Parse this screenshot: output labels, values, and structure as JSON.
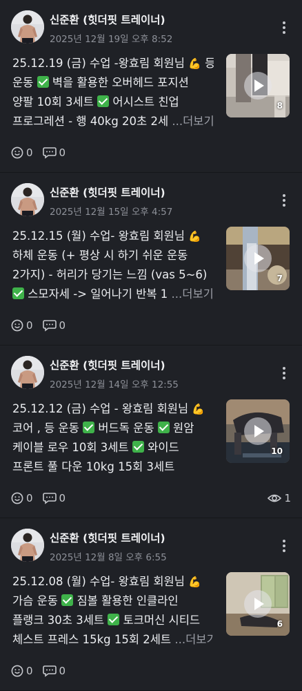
{
  "posts": [
    {
      "author": "신준환 (힛더핏 트레이너)",
      "date": "2025년 12월 19일 오후 8:52",
      "lines": [
        [
          {
            "t": "25.12.19 (금) 수업 -왕효림 회원님 "
          },
          {
            "e": "💪"
          },
          {
            "t": " 등"
          }
        ],
        [
          {
            "t": "운동 "
          },
          {
            "c": 1
          },
          {
            "t": " 벽을 활용한 오버헤드 포지션"
          }
        ],
        [
          {
            "t": "양팔 10회 3세트 "
          },
          {
            "c": 1
          },
          {
            "t": " 어시스트 친업"
          }
        ],
        [
          {
            "t": "프로그레션 - 행 40kg 20초 2세 "
          },
          {
            "m": "...더보기"
          }
        ]
      ],
      "media_count": "8",
      "comment_count": "0",
      "reaction_count": "0",
      "thumb": "t1"
    },
    {
      "author": "신준환 (힛더핏 트레이너)",
      "date": "2025년 12월 15일 오후 4:57",
      "lines": [
        [
          {
            "t": "25.12.15 (월) 수업- 왕효림 회원님 "
          },
          {
            "e": "💪"
          }
        ],
        [
          {
            "t": "하체 운동 (+ 평상 시 하기 쉬운 운동"
          }
        ],
        [
          {
            "t": "2가지) - 허리가 당기는 느낌 (vas 5~6)"
          }
        ],
        [
          {
            "c": 1
          },
          {
            "t": " 스모자세 -> 일어나기 반복 1 "
          },
          {
            "m": "...더보기"
          }
        ]
      ],
      "media_count": "7",
      "comment_count": "0",
      "reaction_count": "0",
      "thumb": "t2"
    },
    {
      "author": "신준환 (힛더핏 트레이너)",
      "date": "2025년 12월 14일 오후 12:55",
      "lines": [
        [
          {
            "t": "25.12.12 (금) 수업 - 왕효림 회원님 "
          },
          {
            "e": "💪"
          }
        ],
        [
          {
            "t": "코어 , 등 운동 "
          },
          {
            "c": 1
          },
          {
            "t": " 버드독 운동 "
          },
          {
            "c": 1
          },
          {
            "t": " 원암"
          }
        ],
        [
          {
            "t": "케이블 로우 10회 3세트 "
          },
          {
            "c": 1
          },
          {
            "t": " 와이드"
          }
        ],
        [
          {
            "t": "프론트 풀 다운 10kg 15회 3세트"
          }
        ]
      ],
      "media_count": "10",
      "comment_count": "0",
      "reaction_count": "0",
      "view_count": "1",
      "thumb": "t3"
    },
    {
      "author": "신준환 (힛더핏 트레이너)",
      "date": "2025년 12월 8일 오후 6:55",
      "lines": [
        [
          {
            "t": "25.12.08 (월) 수업- 왕효림 회원님 "
          },
          {
            "e": "💪"
          }
        ],
        [
          {
            "t": "가슴 운동 "
          },
          {
            "c": 1
          },
          {
            "t": " 짐볼 활용한 인클라인"
          }
        ],
        [
          {
            "t": "플랭크 30초 3세트 "
          },
          {
            "c": 1
          },
          {
            "t": " 토크머신 시티드"
          }
        ],
        [
          {
            "t": "체스트 프레스 15kg 15회 2세트 "
          },
          {
            "m": "...더보기"
          }
        ]
      ],
      "media_count": "6",
      "comment_count": "0",
      "reaction_count": "0",
      "thumb": "t4"
    }
  ],
  "icons": {
    "more": "more-vertical-icon",
    "reaction": "smiley-icon",
    "comment": "comment-bubble-icon",
    "views": "eye-icon",
    "checkmark": "check-mark-button-emoji",
    "flexed_biceps": "flexed-biceps-emoji",
    "play": "play-icon"
  },
  "colors": {
    "background": "#1f2126",
    "checkmark": "#3fb24a",
    "secondary_text": "#8d9098"
  }
}
